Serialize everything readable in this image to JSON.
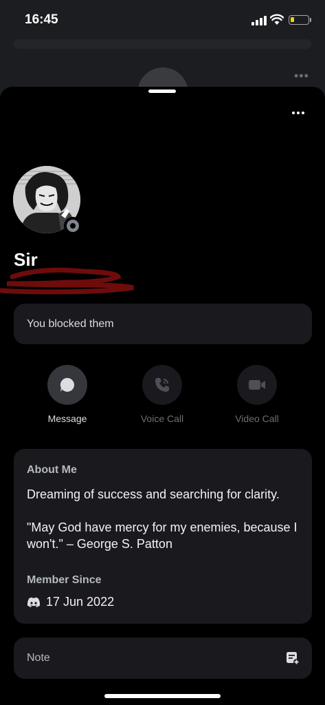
{
  "status_bar": {
    "time": "16:45",
    "battery_level": 0.2,
    "battery_color": "#f5d10a"
  },
  "profile": {
    "display_name": "Sir",
    "status": "offline",
    "blocked_notice": "You blocked them"
  },
  "actions": [
    {
      "label": "Message",
      "icon": "message-bubble-icon",
      "enabled": true
    },
    {
      "label": "Voice Call",
      "icon": "phone-icon",
      "enabled": false
    },
    {
      "label": "Video Call",
      "icon": "video-camera-icon",
      "enabled": false
    }
  ],
  "about": {
    "title": "About Me",
    "line1": "Dreaming of success and searching for clarity.",
    "line2": "\"May God have mercy for my enemies, because I won't.\" – George S. Patton"
  },
  "member_since": {
    "title": "Member Since",
    "icon": "discord-logo-icon",
    "date": "17 Jun 2022"
  },
  "note": {
    "label": "Note",
    "icon": "add-note-icon"
  },
  "colors": {
    "sheet_background": "#000000",
    "card_background": "#1a1a1e",
    "scribble": "#6e0c0c",
    "status_offline": "#80848e"
  }
}
